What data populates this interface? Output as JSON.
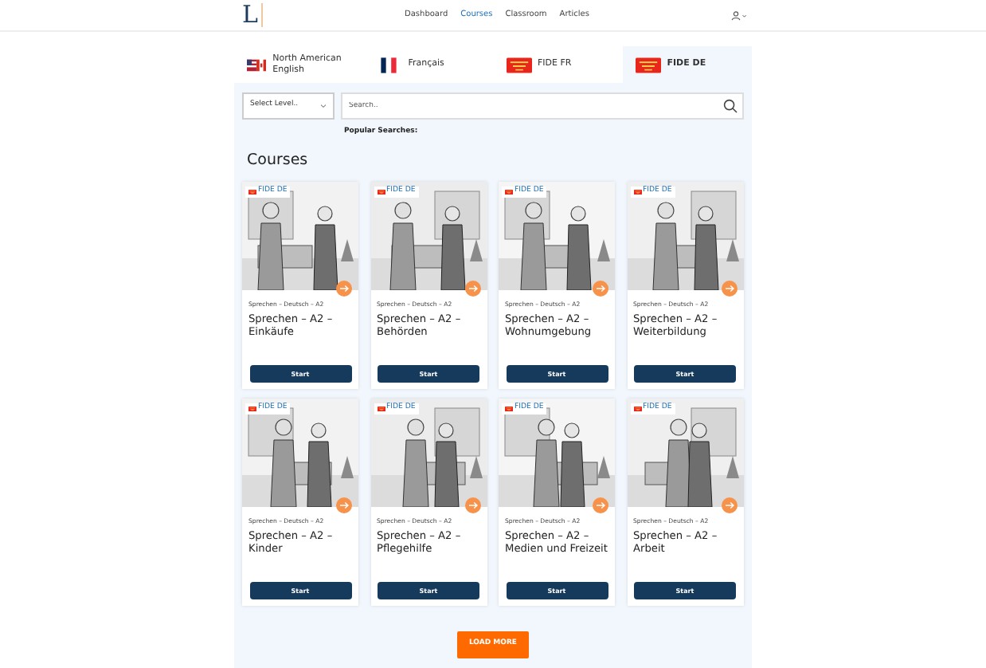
{
  "navbar": {
    "logo": "L",
    "links": [
      {
        "label": "Dashboard",
        "selected": false
      },
      {
        "label": "Courses",
        "selected": true
      },
      {
        "label": "Classroom",
        "selected": false
      },
      {
        "label": "Articles",
        "selected": false
      }
    ]
  },
  "tabs": [
    {
      "label": "North American English",
      "kind": "usca",
      "selected": false
    },
    {
      "label": "Français",
      "kind": "french",
      "selected": false
    },
    {
      "label": "FIDE FR",
      "kind": "fide",
      "selected": false
    },
    {
      "label": "FIDE DE",
      "kind": "fide",
      "selected": true
    }
  ],
  "filters": {
    "level": {
      "placeholder": "Select Level.."
    },
    "search": {
      "placeholder": "Search.."
    },
    "popular_label": "Popular Searches:"
  },
  "section_title": "Courses",
  "courses": [
    {
      "badge": "FIDE DE",
      "breadcrumb": "Sprechen – Deutsch – A2",
      "title": "Sprechen – A2 – Einkäufe",
      "button": "Start"
    },
    {
      "badge": "FIDE DE",
      "breadcrumb": "Sprechen – Deutsch – A2",
      "title": "Sprechen – A2 – Behörden",
      "button": "Start"
    },
    {
      "badge": "FIDE DE",
      "breadcrumb": "Sprechen – Deutsch – A2",
      "title": "Sprechen – A2 – Wohnumgebung",
      "button": "Start"
    },
    {
      "badge": "FIDE DE",
      "breadcrumb": "Sprechen – Deutsch – A2",
      "title": "Sprechen – A2 – Weiterbildung",
      "button": "Start"
    },
    {
      "badge": "FIDE DE",
      "breadcrumb": "Sprechen – Deutsch – A2",
      "title": "Sprechen – A2 – Kinder",
      "button": "Start"
    },
    {
      "badge": "FIDE DE",
      "breadcrumb": "Sprechen – Deutsch – A2",
      "title": "Sprechen – A2 – Pflegehilfe",
      "button": "Start"
    },
    {
      "badge": "FIDE DE",
      "breadcrumb": "Sprechen – Deutsch – A2",
      "title": "Sprechen – A2 – Medien und Freizeit",
      "button": "Start"
    },
    {
      "badge": "FIDE DE",
      "breadcrumb": "Sprechen – Deutsch – A2",
      "title": "Sprechen – A2 – Arbeit",
      "button": "Start"
    }
  ],
  "load_more": "LOAD MORE"
}
